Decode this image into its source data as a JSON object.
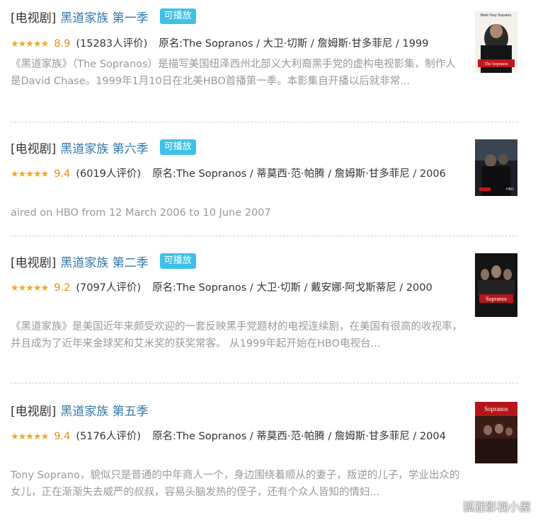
{
  "items": [
    {
      "category": "[电视剧]",
      "title": "黑道家族 第一季",
      "badge": "可播放",
      "stars": "★★★★★",
      "score": "8.9",
      "count": "(15283人评价)",
      "original": "原名:The Sopranos / 大卫·切斯 / 詹姆斯·甘多菲尼 / 1999",
      "description": "《黑道家族》（The Sopranos）是描写美国纽泽西州北部义大利裔黑手党的虚构电视影集，制作人是David Chase。1999年1月10日在北美HBO首播第一季。本影集自开播以后就非常...",
      "poster_text": "Meet Tony Soprano.",
      "poster_logo": "The Sopranos"
    },
    {
      "category": "[电视剧]",
      "title": "黑道家族 第六季",
      "badge": "可播放",
      "stars": "★★★★★",
      "score": "9.4",
      "count": "(6019人评价)",
      "original": "原名:The Sopranos / 蒂莫西·范·帕腾 / 詹姆斯·甘多菲尼 / 2006",
      "description": "aired on HBO from 12 March 2006 to 10 June 2007",
      "poster_logo": "HBO"
    },
    {
      "category": "[电视剧]",
      "title": "黑道家族 第二季",
      "badge": "可播放",
      "stars": "★★★★★",
      "score": "9.2",
      "count": "(7097人评价)",
      "original": "原名:The Sopranos / 大卫·切斯 / 戴安娜·阿戈斯蒂尼 / 2000",
      "description": "《黑道家族》是美国近年来颇受欢迎的一套反映黑手党题材的电视连续剧，在美国有很高的收视率，并且成为了近年来金球奖和艾米奖的获奖常客。 从1999年起开始在HBO电视台...",
      "poster_logo": "Sopranos"
    },
    {
      "category": "[电视剧]",
      "title": "黑道家族 第五季",
      "badge": "",
      "stars": "★★★★★",
      "score": "9.4",
      "count": "(5176人评价)",
      "original": "原名:The Sopranos / 蒂莫西·范·帕腾 / 詹姆斯·甘多菲尼 / 2004",
      "description": "Tony Soprano，貌似只是普通的中年商人一个，身边围绕着顺从的妻子，叛逆的儿子，学业出众的女儿，正在渐渐失去威严的叔叔，容易头脑发热的侄子，还有个众人皆知的情妇...",
      "poster_logo": "Sopranos"
    }
  ],
  "watermark": "狐狸影视小屋",
  "colors": {
    "link": "#3377aa",
    "badge": "#40c0e8",
    "star": "#f5a623",
    "score": "#e09015",
    "desc": "#999999"
  }
}
